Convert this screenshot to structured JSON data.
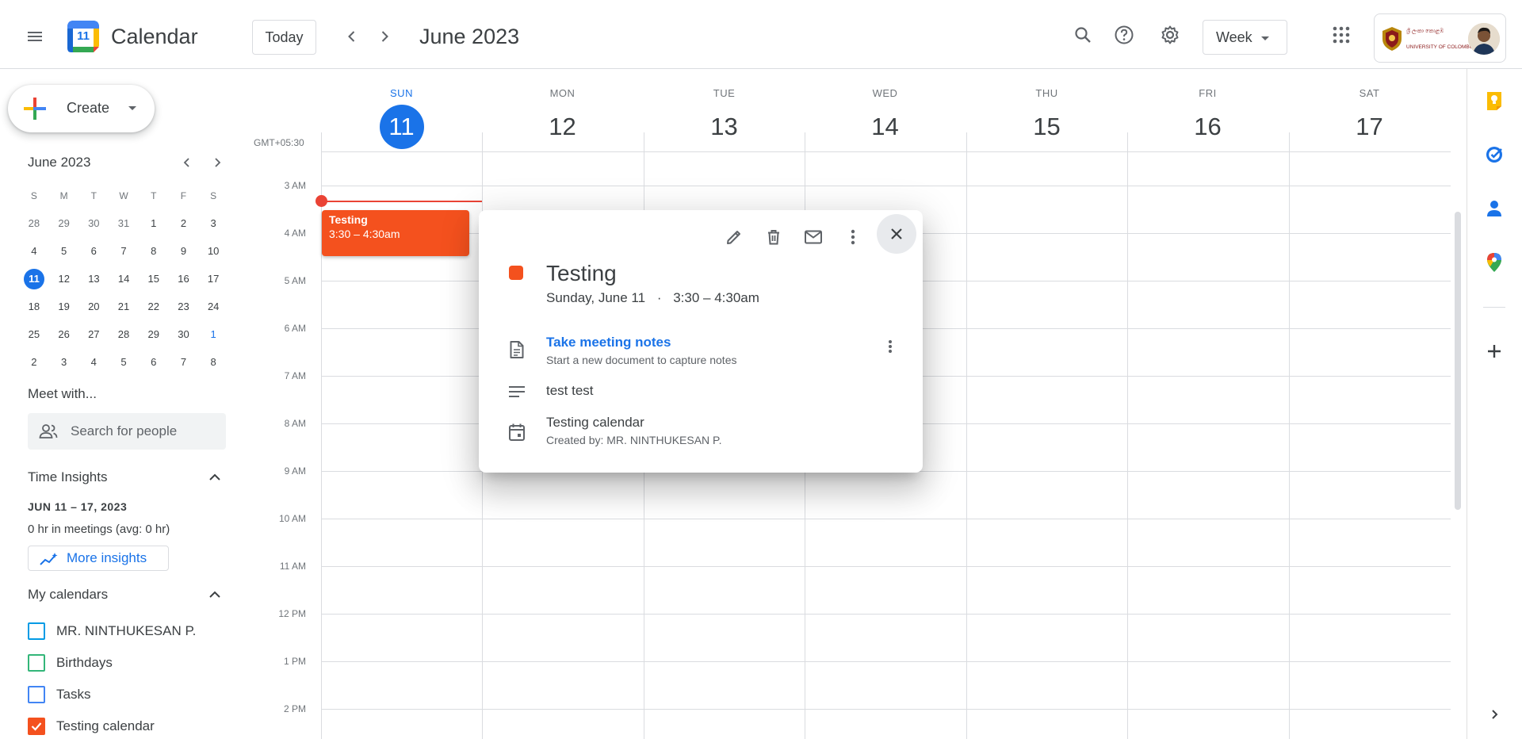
{
  "header": {
    "app_name": "Calendar",
    "logo_number": "11",
    "today_label": "Today",
    "current_range": "June 2023",
    "view_label": "Week",
    "org_text_1": "ශ්‍රී ලංකා කොළඹ",
    "org_text_2": "UNIVERSITY OF COLOMBO"
  },
  "sidebar": {
    "create_label": "Create",
    "mini_calendar": {
      "title": "June 2023",
      "weekday_headers": [
        "S",
        "M",
        "T",
        "W",
        "T",
        "F",
        "S"
      ],
      "weeks": [
        [
          "28",
          "29",
          "30",
          "31",
          "1",
          "2",
          "3"
        ],
        [
          "4",
          "5",
          "6",
          "7",
          "8",
          "9",
          "10"
        ],
        [
          "11",
          "12",
          "13",
          "14",
          "15",
          "16",
          "17"
        ],
        [
          "18",
          "19",
          "20",
          "21",
          "22",
          "23",
          "24"
        ],
        [
          "25",
          "26",
          "27",
          "28",
          "29",
          "30",
          "1"
        ],
        [
          "2",
          "3",
          "4",
          "5",
          "6",
          "7",
          "8"
        ]
      ],
      "selected_day": "11"
    },
    "meet_with": {
      "title": "Meet with...",
      "search_placeholder": "Search for people"
    },
    "time_insights": {
      "title": "Time Insights",
      "range": "JUN 11 – 17, 2023",
      "summary": "0 hr in meetings (avg: 0 hr)",
      "more_label": "More insights"
    },
    "my_calendars": {
      "title": "My calendars",
      "items": [
        {
          "label": "MR. NINTHUKESAN P.",
          "color": "#039be5",
          "checked": false
        },
        {
          "label": "Birthdays",
          "color": "#33b679",
          "checked": false
        },
        {
          "label": "Tasks",
          "color": "#4285f4",
          "checked": false
        },
        {
          "label": "Testing calendar",
          "color": "#f4511e",
          "checked": true
        }
      ]
    }
  },
  "week": {
    "timezone": "GMT+05:30",
    "days": [
      {
        "dow": "SUN",
        "num": "11",
        "active": true
      },
      {
        "dow": "MON",
        "num": "12",
        "active": false
      },
      {
        "dow": "TUE",
        "num": "13",
        "active": false
      },
      {
        "dow": "WED",
        "num": "14",
        "active": false
      },
      {
        "dow": "THU",
        "num": "15",
        "active": false
      },
      {
        "dow": "FRI",
        "num": "16",
        "active": false
      },
      {
        "dow": "SAT",
        "num": "17",
        "active": false
      }
    ],
    "hours": [
      "3 AM",
      "4 AM",
      "5 AM",
      "6 AM",
      "7 AM",
      "8 AM",
      "9 AM",
      "10 AM",
      "11 AM",
      "12 PM",
      "1 PM",
      "2 PM"
    ]
  },
  "event": {
    "title": "Testing",
    "time": "3:30 – 4:30am",
    "color": "#f4511e"
  },
  "popover": {
    "title": "Testing",
    "date": "Sunday, June 11",
    "separator": "·",
    "time": "3:30 – 4:30am",
    "notes_link": "Take meeting notes",
    "notes_sub": "Start a new document to capture notes",
    "description": "test test",
    "calendar_name": "Testing calendar",
    "created_by": "Created by: MR. NINTHUKESAN P."
  },
  "colors": {
    "accent": "#1a73e8",
    "event": "#f4511e",
    "now_line": "#ea4335"
  }
}
